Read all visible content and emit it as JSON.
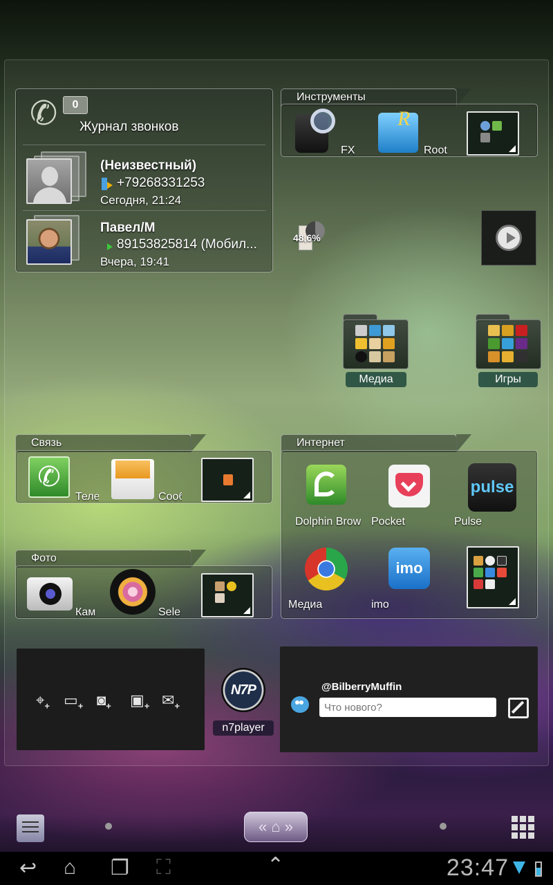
{
  "calllog": {
    "title": "Журнал звонков",
    "badge": "0",
    "entries": [
      {
        "name": "(Неизвестный)",
        "number": "+79268331253",
        "time": "Сегодня, 21:24"
      },
      {
        "name": "Павел/М",
        "number": "89153825814 (Мобил...",
        "time": "Вчера, 19:41"
      }
    ]
  },
  "tools": {
    "title": "Инструменты",
    "apps": [
      {
        "label": "FX"
      },
      {
        "label": "Root"
      }
    ]
  },
  "battery_widget": {
    "value": "48,6%"
  },
  "desktop_folders": [
    {
      "label": "Медиа"
    },
    {
      "label": "Игры"
    }
  ],
  "svyaz": {
    "title": "Связь",
    "apps": [
      {
        "label": "Теле"
      },
      {
        "label": "Сооб"
      }
    ]
  },
  "foto": {
    "title": "Фото",
    "apps": [
      {
        "label": "Кам"
      },
      {
        "label": "Sele"
      }
    ]
  },
  "internet": {
    "title": "Интернет",
    "apps": [
      {
        "label": "Dolphin Brow"
      },
      {
        "label": "Pocket"
      },
      {
        "label": "Pulse",
        "icon_text": "pulse"
      },
      {
        "label": "Медиа"
      },
      {
        "label": "imo",
        "icon_text": "imo"
      }
    ]
  },
  "n7player": {
    "label": "n7player",
    "icon_text": "N7P"
  },
  "twitter": {
    "handle": "@BilberryMuffin",
    "placeholder": "Что нового?"
  },
  "clock": "23:47",
  "colors": {
    "accent_blue": "#3fb6e6",
    "folder_label_bg": "#1e463c"
  }
}
